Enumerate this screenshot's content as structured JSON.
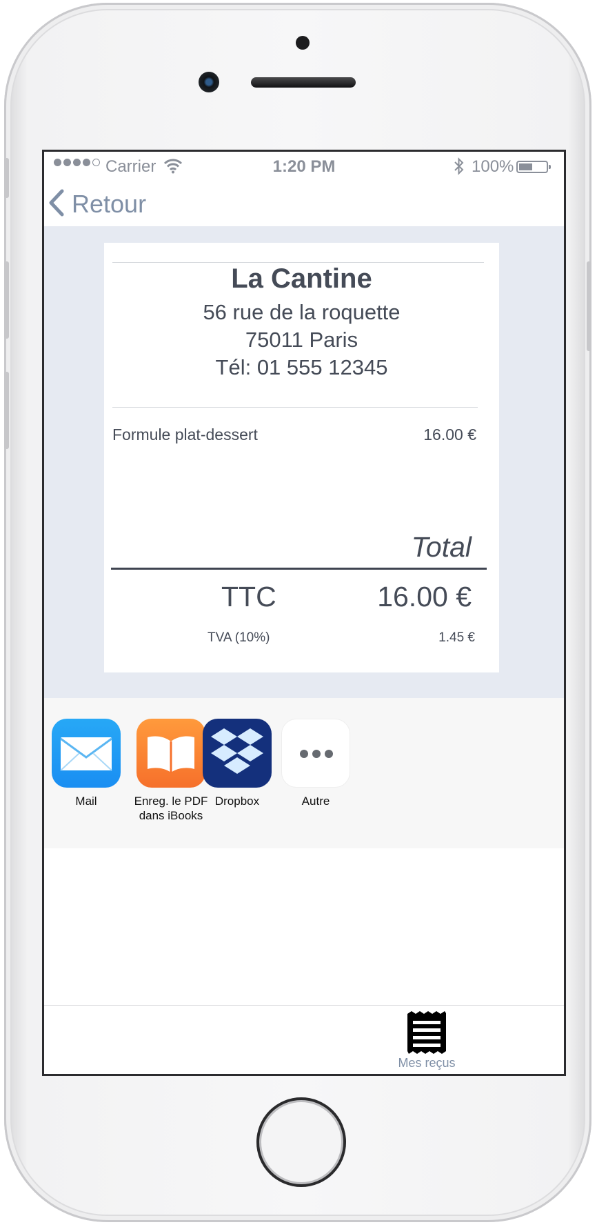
{
  "status_bar": {
    "carrier": "Carrier",
    "time": "1:20 PM",
    "battery": "100%"
  },
  "nav": {
    "back_label": "Retour"
  },
  "receipt": {
    "shop_name": "La Cantine",
    "address_line1": "56 rue de la roquette",
    "address_line2": "75011 Paris",
    "phone": "Tél: 01 555 12345",
    "items": [
      {
        "name": "Formule plat-dessert",
        "price": "16.00 €"
      }
    ],
    "total_label": "Total",
    "ttc_label": "TTC",
    "ttc_value": "16.00 €",
    "tva_label": "TVA (10%)",
    "tva_value": "1.45 €"
  },
  "share": {
    "items": [
      {
        "label": "Mail",
        "icon": "mail-icon"
      },
      {
        "label": "Enreg. le PDF",
        "label2": "dans iBooks",
        "icon": "ibooks-icon"
      },
      {
        "label": "Dropbox",
        "icon": "dropbox-icon"
      },
      {
        "label": "Autre",
        "icon": "more-icon"
      }
    ]
  },
  "tab_bar": {
    "items": [
      {
        "label": "Mes reçus",
        "icon": "receipt-icon"
      }
    ]
  },
  "colors": {
    "accent": "#7f8fa6",
    "receipt_bg": "#e6eaf2",
    "text": "#454b57"
  }
}
